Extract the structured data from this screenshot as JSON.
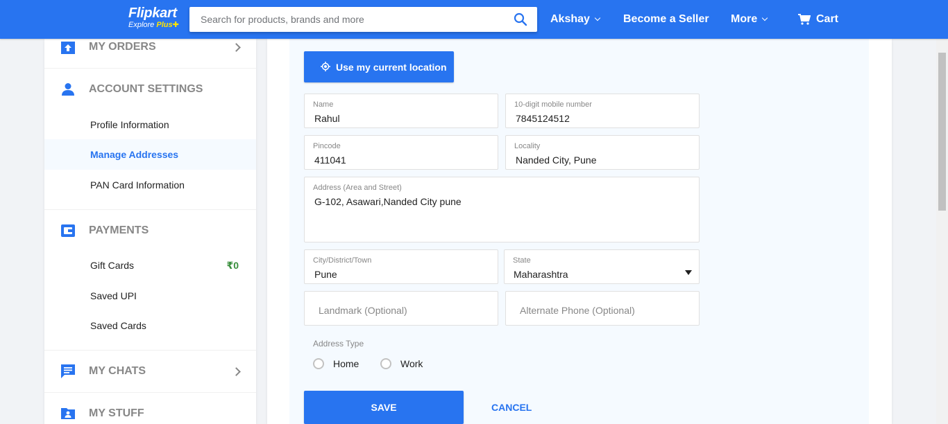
{
  "header": {
    "logo": {
      "brand": "Flipkart",
      "tag_prefix": "Explore ",
      "tag_plus": "Plus"
    },
    "search": {
      "placeholder": "Search for products, brands and more"
    },
    "user_label": "Akshay",
    "seller_label": "Become a Seller",
    "more_label": "More",
    "cart_label": "Cart"
  },
  "sidebar": {
    "my_orders": "MY ORDERS",
    "account_settings": {
      "title": "ACCOUNT SETTINGS",
      "items": [
        "Profile Information",
        "Manage Addresses",
        "PAN Card Information"
      ],
      "active_index": 1
    },
    "payments": {
      "title": "PAYMENTS",
      "items": [
        {
          "label": "Gift Cards",
          "value": "₹0"
        },
        {
          "label": "Saved UPI",
          "value": ""
        },
        {
          "label": "Saved Cards",
          "value": ""
        }
      ]
    },
    "my_chats": "MY CHATS",
    "my_stuff": "MY STUFF"
  },
  "form": {
    "location_button": "Use my current location",
    "name": {
      "label": "Name",
      "value": "Rahul"
    },
    "mobile": {
      "label": "10-digit mobile number",
      "value": "7845124512"
    },
    "pincode": {
      "label": "Pincode",
      "value": "411041"
    },
    "locality": {
      "label": "Locality",
      "value": "Nanded City, Pune"
    },
    "address": {
      "label": "Address (Area and Street)",
      "value": "G-102, Asawari,Nanded City pune"
    },
    "city": {
      "label": "City/District/Town",
      "value": "Pune"
    },
    "state": {
      "label": "State",
      "value": "Maharashtra"
    },
    "landmark": {
      "placeholder": "Landmark (Optional)"
    },
    "alt_phone": {
      "placeholder": "Alternate Phone (Optional)"
    },
    "address_type": {
      "label": "Address Type",
      "options": [
        "Home",
        "Work"
      ]
    },
    "save_label": "SAVE",
    "cancel_label": "CANCEL"
  },
  "colors": {
    "primary": "#2874f0",
    "accent_yellow": "#ffe500",
    "green": "#388e3c",
    "muted": "#878787"
  }
}
